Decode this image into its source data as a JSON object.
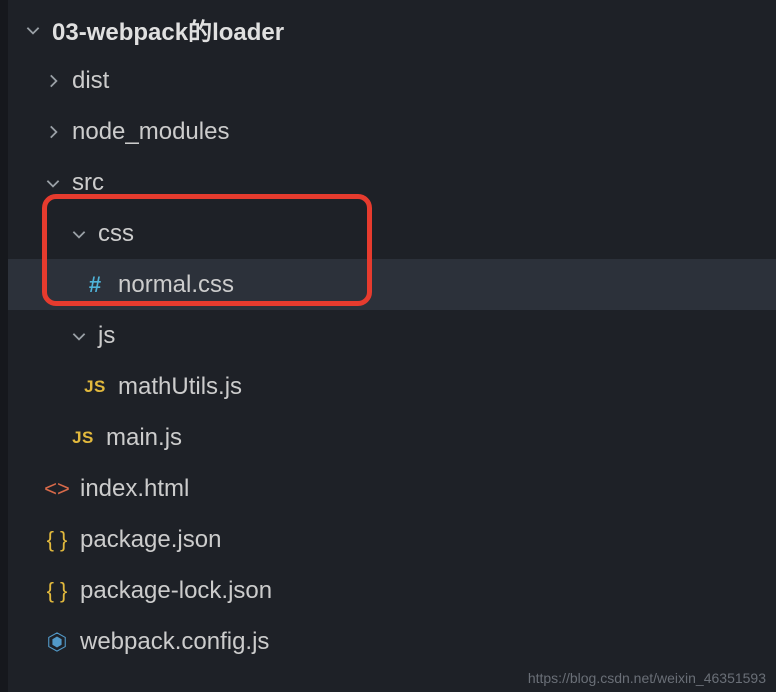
{
  "tree": {
    "root": {
      "label": "03-webpack的loader"
    },
    "dist": {
      "label": "dist"
    },
    "node_modules": {
      "label": "node_modules"
    },
    "src": {
      "label": "src"
    },
    "css": {
      "label": "css"
    },
    "normal_css": {
      "label": "normal.css"
    },
    "js": {
      "label": "js"
    },
    "math_utils": {
      "label": "mathUtils.js"
    },
    "main_js": {
      "label": "main.js"
    },
    "index_html": {
      "label": "index.html"
    },
    "package_json": {
      "label": "package.json"
    },
    "package_lock": {
      "label": "package-lock.json"
    },
    "webpack_config": {
      "label": "webpack.config.js"
    }
  },
  "icons": {
    "js": "JS",
    "hash": "#",
    "braces": "{ }",
    "angles": "<>"
  },
  "watermark": "https://blog.csdn.net/weixin_46351593"
}
